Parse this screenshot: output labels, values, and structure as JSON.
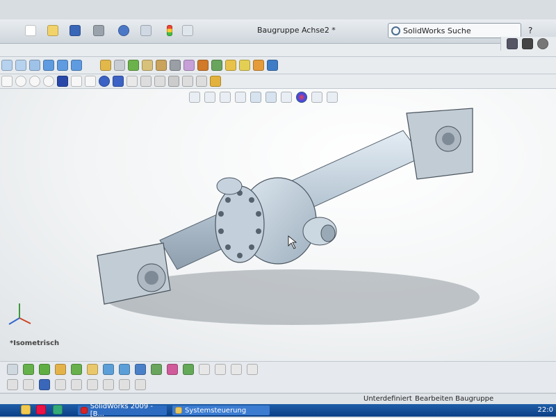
{
  "window": {
    "title": "Baugruppe Achse2 *"
  },
  "search": {
    "label": "SolidWorks Suche"
  },
  "help": {
    "label": "?"
  },
  "viewport": {
    "view_name": "*Isometrisch"
  },
  "status": {
    "state": "Unterdefiniert",
    "mode": "Bearbeiten Baugruppe"
  },
  "taskbar": {
    "items": [
      {
        "label": "SolidWorks 2009 - [B..."
      },
      {
        "label": "Systemsteuerung"
      }
    ],
    "clock": "22:0"
  },
  "colors": {
    "accent": "#1f5ea8",
    "model": "#b7c4cf",
    "viewport_bg": "#f2f4f5"
  }
}
